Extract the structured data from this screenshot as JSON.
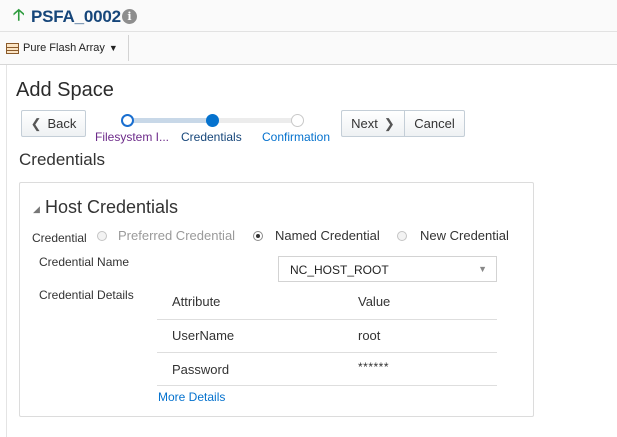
{
  "header": {
    "title": "PSFA_0002",
    "arrow_icon": "up-arrow-icon",
    "info_icon_glyph": "i"
  },
  "target_menu": {
    "label": "Pure Flash Array",
    "caret": "▼"
  },
  "page": {
    "heading": "Add Space"
  },
  "train": {
    "back_label": "Back",
    "next_label": "Next",
    "cancel_label": "Cancel",
    "steps": [
      {
        "label": "Filesystem I...",
        "state": "visited"
      },
      {
        "label": "Credentials",
        "state": "current"
      },
      {
        "label": "Confirmation",
        "state": "unvisited"
      }
    ]
  },
  "section": {
    "heading": "Credentials"
  },
  "host_credentials": {
    "title": "Host Credentials",
    "disclosure_glyph": "◢",
    "credential_label": "Credential",
    "options": [
      {
        "label": "Preferred Credential",
        "selected": false,
        "disabled": true
      },
      {
        "label": "Named Credential",
        "selected": true,
        "disabled": false
      },
      {
        "label": "New Credential",
        "selected": false,
        "disabled": false
      }
    ],
    "credential_name_label": "Credential Name",
    "credential_name_value": "NC_HOST_ROOT",
    "credential_details_label": "Credential Details",
    "table": {
      "columns": [
        "Attribute",
        "Value"
      ],
      "rows": [
        [
          "UserName",
          "root"
        ],
        [
          "Password",
          "******"
        ]
      ]
    },
    "more_details": "More Details"
  },
  "colors": {
    "title_blue": "#16467a",
    "link_blue": "#0572ce",
    "arrow_green": "#2e9c3e",
    "visited_purple": "#6d2b8a"
  }
}
